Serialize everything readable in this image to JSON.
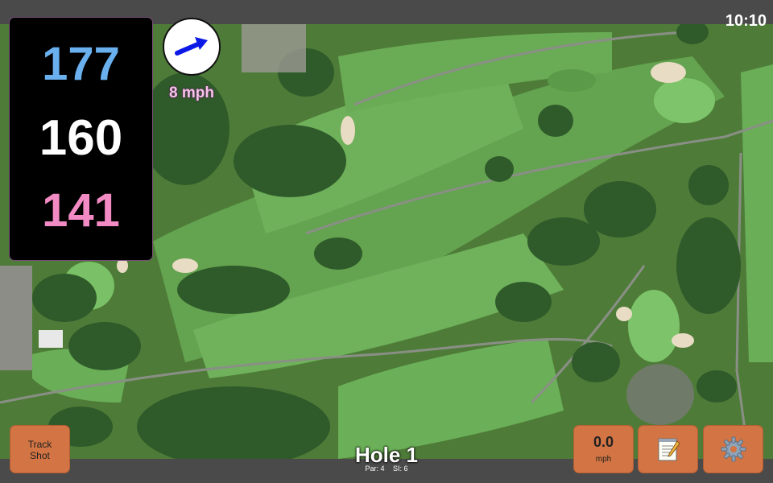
{
  "status": {
    "time": "10:10"
  },
  "distances": {
    "back": "177",
    "middle": "160",
    "front": "141"
  },
  "wind": {
    "speed": "8 mph",
    "icon": "wind-arrow-icon"
  },
  "buttons": {
    "track_shot_line1": "Track",
    "track_shot_line2": "Shot",
    "speed_value": "0.0",
    "speed_unit": "mph",
    "notes_icon": "notepad-icon",
    "settings_icon": "gear-icon"
  },
  "hole": {
    "title": "Hole 1",
    "par": "Par: 4",
    "si": "SI: 6"
  },
  "colors": {
    "back_distance": "#6ab0ee",
    "middle_distance": "#ffffff",
    "front_distance": "#f28bc4",
    "button": "#d27443",
    "wind_text": "#f6c2ea"
  }
}
